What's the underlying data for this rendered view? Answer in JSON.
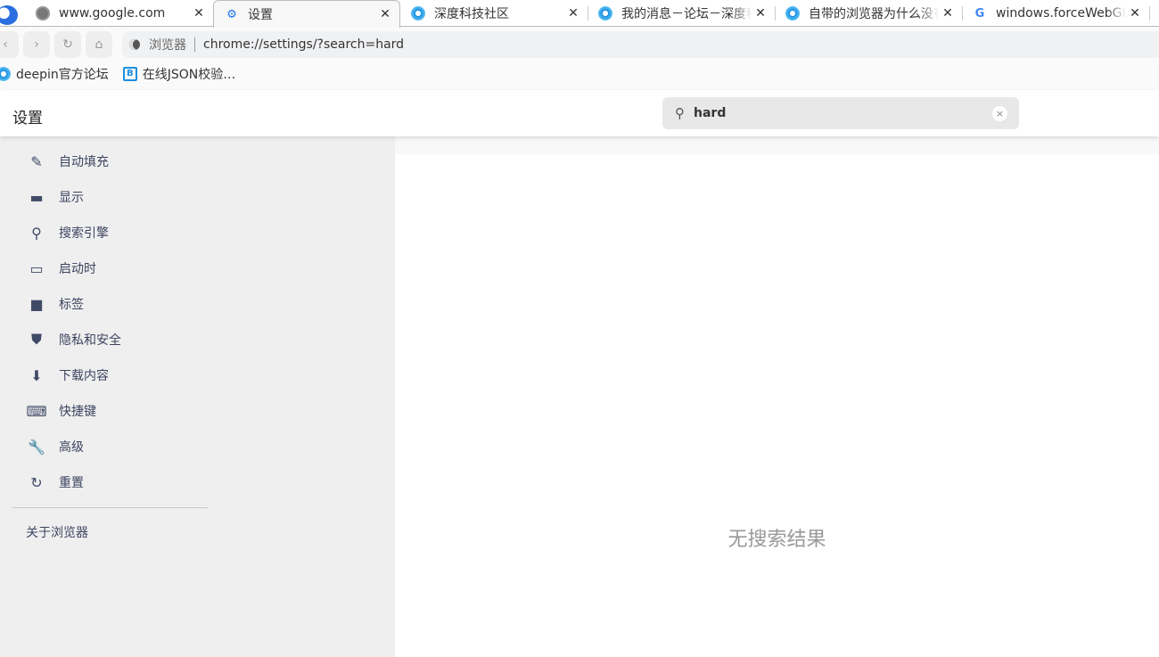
{
  "tabs": [
    {
      "title": "www.google.com",
      "icon": "globe-icon"
    },
    {
      "title": "设置",
      "icon": "gear-icon",
      "active": true
    },
    {
      "title": "深度科技社区",
      "icon": "deepin-icon"
    },
    {
      "title": "我的消息－论坛－深度科",
      "icon": "deepin-icon"
    },
    {
      "title": "自带的浏览器为什么没有",
      "icon": "deepin-icon"
    },
    {
      "title": "windows.forceWebGL",
      "icon": "google-icon"
    }
  ],
  "close_glyph": "✕",
  "toolbar": {
    "back": "‹",
    "forward": "›",
    "reload": "↻",
    "home": "⌂",
    "site_label": "浏览器",
    "url": "chrome://settings/?search=hard"
  },
  "bookmarks": [
    {
      "label": "deepin官方论坛"
    },
    {
      "label": "在线JSON校验…",
      "icon_text": "B"
    }
  ],
  "header": {
    "title": "设置",
    "search_value": "hard",
    "clear": "×"
  },
  "sidebar": {
    "items": [
      {
        "label": "自动填充",
        "icon": "✎"
      },
      {
        "label": "显示",
        "icon": "▬"
      },
      {
        "label": "搜索引擎",
        "icon": "⚲"
      },
      {
        "label": "启动时",
        "icon": "▭"
      },
      {
        "label": "标签",
        "icon": "■"
      },
      {
        "label": "隐私和安全",
        "icon": "⛊"
      },
      {
        "label": "下载内容",
        "icon": "⬇"
      },
      {
        "label": "快捷键",
        "icon": "⌨"
      },
      {
        "label": "高级",
        "icon": "🔧"
      },
      {
        "label": "重置",
        "icon": "↻"
      }
    ],
    "about": "关于浏览器"
  },
  "main": {
    "no_results": "无搜索结果"
  }
}
